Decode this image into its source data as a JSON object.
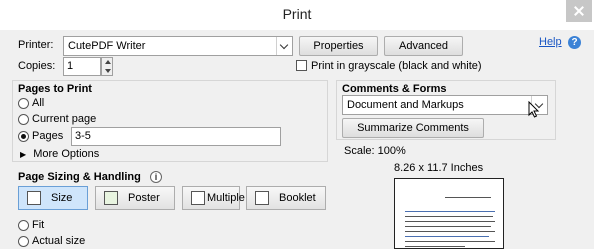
{
  "window": {
    "title": "Print"
  },
  "printer": {
    "label": "Printer:",
    "value": "CutePDF Writer",
    "properties_label": "Properties",
    "advanced_label": "Advanced"
  },
  "help": {
    "label": "Help"
  },
  "copies": {
    "label": "Copies:",
    "value": "1"
  },
  "grayscale": {
    "label": "Print in grayscale (black and white)",
    "checked": false
  },
  "pages_to_print": {
    "heading": "Pages to Print",
    "all_label": "All",
    "current_label": "Current page",
    "pages_label": "Pages",
    "pages_value": "3-5",
    "more_options_label": "More Options",
    "selected": "pages"
  },
  "comments_forms": {
    "heading": "Comments & Forms",
    "value": "Document and Markups",
    "summarize_label": "Summarize Comments"
  },
  "preview": {
    "scale": "Scale: 100%",
    "page_size": "8.26 x 11.7 Inches"
  },
  "page_sizing": {
    "heading": "Page Sizing & Handling",
    "buttons": [
      "Size",
      "Poster",
      "Multiple",
      "Booklet"
    ],
    "fit_label": "Fit",
    "actual_label": "Actual size"
  }
}
